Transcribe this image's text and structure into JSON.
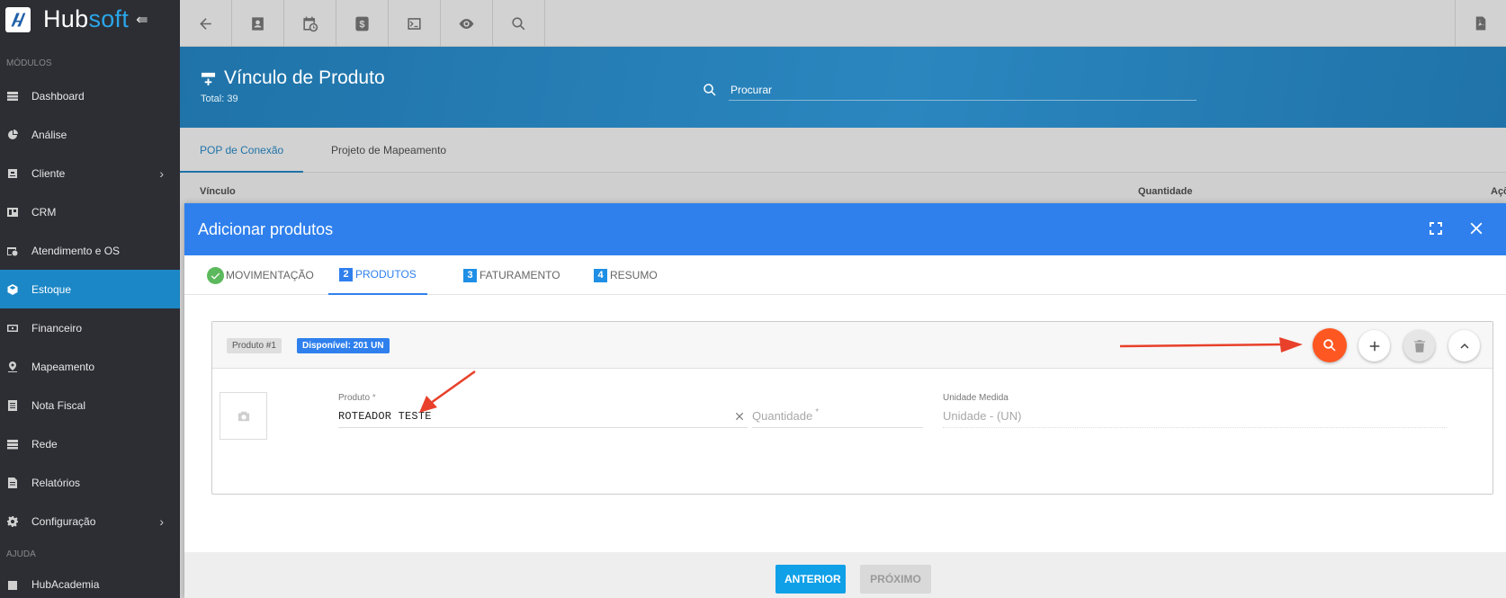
{
  "sidebar": {
    "brand_hub": "Hub",
    "brand_soft": "soft",
    "section_modules": "MÓDULOS",
    "section_help": "AJUDA",
    "items": [
      {
        "label": "Dashboard",
        "icon": "dashboard-icon",
        "has_sub": false,
        "active": false
      },
      {
        "label": "Análise",
        "icon": "pie-chart-icon",
        "has_sub": false,
        "active": false
      },
      {
        "label": "Cliente",
        "icon": "contact-card-icon",
        "has_sub": true,
        "active": false
      },
      {
        "label": "CRM",
        "icon": "crm-board-icon",
        "has_sub": false,
        "active": false
      },
      {
        "label": "Atendimento e OS",
        "icon": "calendar-clock-icon",
        "has_sub": false,
        "active": false
      },
      {
        "label": "Estoque",
        "icon": "box-icon",
        "has_sub": false,
        "active": true
      },
      {
        "label": "Financeiro",
        "icon": "money-icon",
        "has_sub": false,
        "active": false
      },
      {
        "label": "Mapeamento",
        "icon": "map-pin-icon",
        "has_sub": false,
        "active": false
      },
      {
        "label": "Nota Fiscal",
        "icon": "document-icon",
        "has_sub": false,
        "active": false
      },
      {
        "label": "Rede",
        "icon": "network-icon",
        "has_sub": false,
        "active": false
      },
      {
        "label": "Relatórios",
        "icon": "report-icon",
        "has_sub": false,
        "active": false
      },
      {
        "label": "Configuração",
        "icon": "gear-icon",
        "has_sub": true,
        "active": false
      }
    ],
    "help_items": [
      {
        "label": "HubAcademia",
        "icon": "academy-icon"
      }
    ]
  },
  "header": {
    "title": "Vínculo de Produto",
    "total": "Total: 39",
    "search_placeholder": "Procurar"
  },
  "page_tabs": [
    {
      "label": "POP de Conexão",
      "active": true
    },
    {
      "label": "Projeto de Mapeamento",
      "active": false
    }
  ],
  "table_headers": {
    "vinculo": "Vínculo",
    "quantidade": "Quantidade",
    "acoes": "Açõ"
  },
  "modal": {
    "title": "Adicionar produtos",
    "steps": [
      {
        "num": "",
        "label": "MOVIMENTAÇÃO",
        "done": true,
        "active": false
      },
      {
        "num": "2",
        "label": "PRODUTOS",
        "done": false,
        "active": true
      },
      {
        "num": "3",
        "label": "FATURAMENTO",
        "done": false,
        "active": false
      },
      {
        "num": "4",
        "label": "RESUMO",
        "done": false,
        "active": false
      }
    ],
    "product": {
      "badge_label": "Produto #1",
      "badge_available": "Disponível: 201 UN",
      "produto_label": "Produto",
      "produto_value": "ROTEADOR TESTE",
      "quantidade_placeholder": "Quantidade",
      "unidade_label": "Unidade Medida",
      "unidade_value": "Unidade - (UN)",
      "required_mark": "*"
    },
    "buttons": {
      "previous": "ANTERIOR",
      "next": "PRÓXIMO"
    }
  },
  "colors": {
    "sidebar_bg": "#2d2e34",
    "active_nav": "#1c87c6",
    "modal_header": "#2f80ed",
    "search_button": "#ff5722",
    "annotation_arrow": "#e8402a"
  }
}
